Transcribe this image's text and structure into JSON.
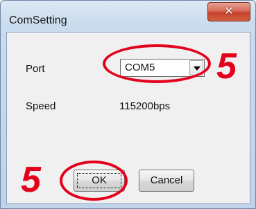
{
  "window": {
    "title": "ComSetting",
    "close_icon": "✕"
  },
  "form": {
    "port_label": "Port",
    "port_value": "COM5",
    "speed_label": "Speed",
    "speed_value": "115200bps"
  },
  "buttons": {
    "ok": "OK",
    "cancel": "Cancel"
  },
  "annotations": {
    "port_step": "5",
    "ok_step": "5",
    "color": "#e3001b"
  }
}
